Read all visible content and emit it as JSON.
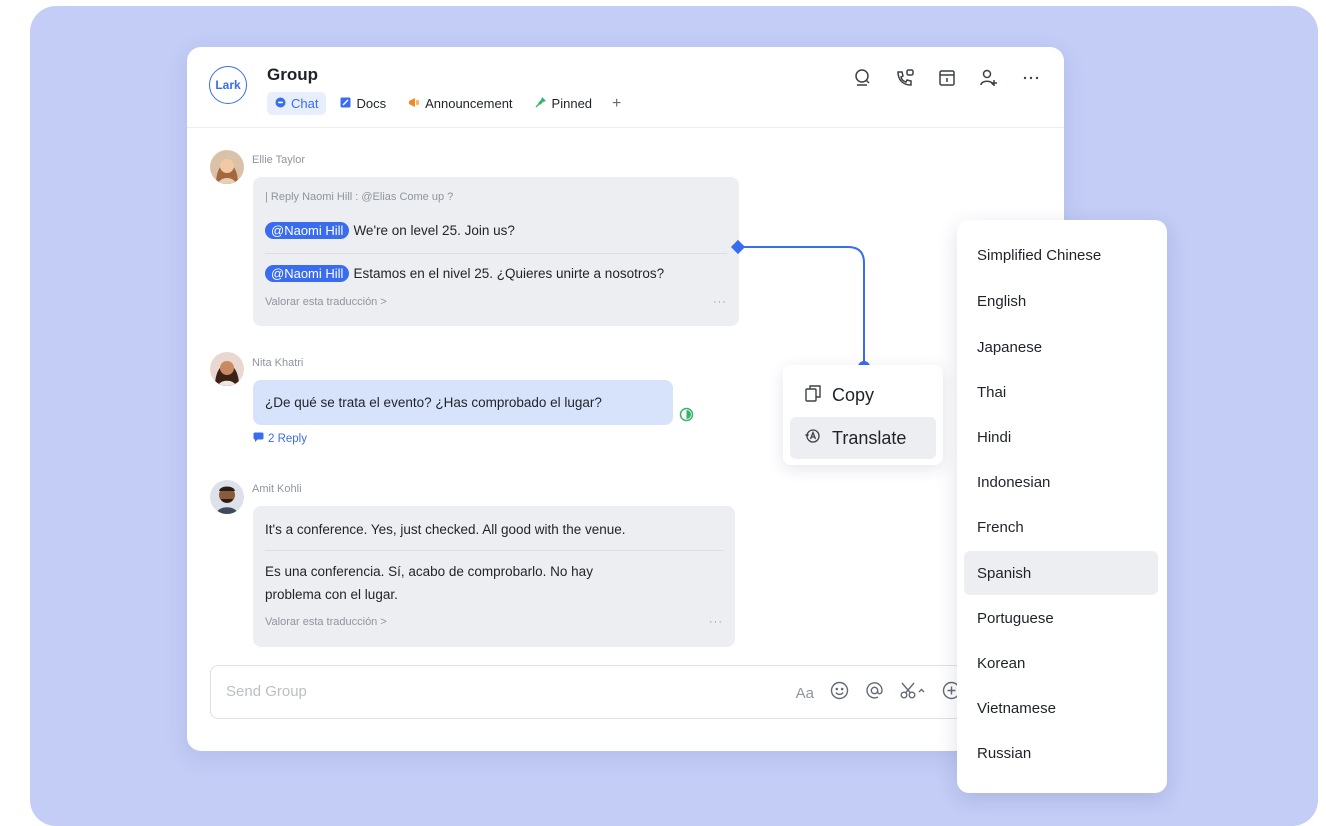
{
  "window": {
    "logo_text": "Lark",
    "title": "Group",
    "tabs": [
      {
        "label": "Chat",
        "icon": "chat-bubble-icon",
        "color": "#3a6cf0"
      },
      {
        "label": "Docs",
        "icon": "docs-icon",
        "color": "#3a6cf0"
      },
      {
        "label": "Announcement",
        "icon": "megaphone-icon",
        "color": "#f08a24"
      },
      {
        "label": "Pinned",
        "icon": "pin-icon",
        "color": "#34b36b"
      }
    ],
    "add_tab": "+",
    "header_icons": [
      "search-icon",
      "phone-icon",
      "calendar-icon",
      "add-member-icon",
      "more-icon"
    ]
  },
  "messages": [
    {
      "sender": "Ellie Taylor",
      "reply_quote": "| Reply Naomi Hill : @Elias Come up ?",
      "mention": "@Naomi Hill",
      "text": "We're on level 25. Join us?",
      "translation_mention": "@Naomi Hill",
      "translation": "Estamos en el nivel 25. ¿Quieres unirte a nosotros?",
      "rate": "Valorar esta traducción  >",
      "more": "···"
    },
    {
      "sender": "Nita Khatri",
      "text": "¿De qué se trata el evento? ¿Has comprobado el lugar?",
      "reply_count": "2 Reply"
    },
    {
      "sender": "Amit Kohli",
      "text": "It's a conference. Yes, just checked. All good with the venue.",
      "translation_line1": "Es una conferencia. Sí, acabo de comprobarlo. No hay",
      "translation_line2": "problema con el lugar.",
      "rate": "Valorar esta traducción  >",
      "more": "···"
    }
  ],
  "composer": {
    "placeholder": "Send Group",
    "font_label": "Aa"
  },
  "context_menu": [
    {
      "label": "Copy",
      "icon": "copy-icon"
    },
    {
      "label": "Translate",
      "icon": "translate-icon",
      "highlighted": true
    }
  ],
  "languages": [
    "Simplified Chinese",
    "English",
    "Japanese",
    "Thai",
    "Hindi",
    "Indonesian",
    "French",
    "Spanish",
    "Portuguese",
    "Korean",
    "Vietnamese",
    "Russian"
  ],
  "selected_language": "Spanish",
  "colors": {
    "accent": "#3a6cf0",
    "background": "#c3cdf6",
    "connector": "#3a6cf0"
  }
}
